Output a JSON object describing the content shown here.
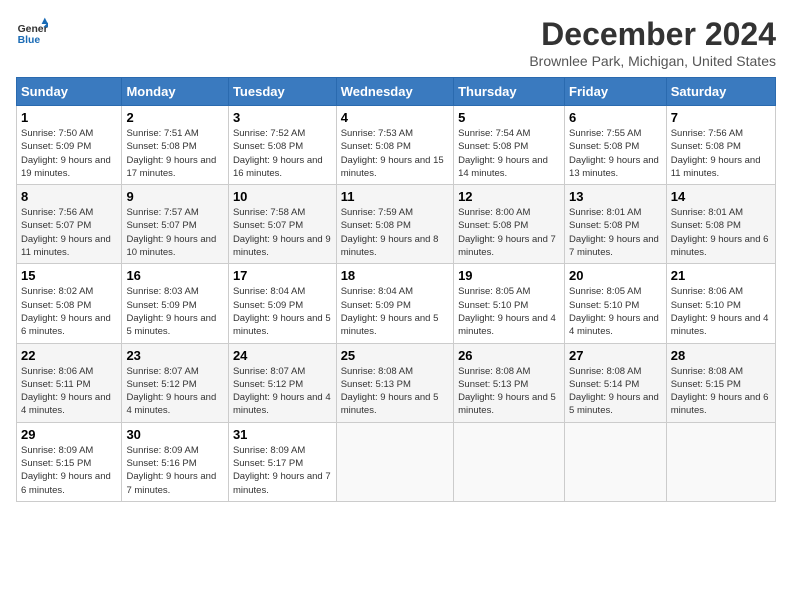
{
  "header": {
    "logo_line1": "General",
    "logo_line2": "Blue",
    "title": "December 2024",
    "subtitle": "Brownlee Park, Michigan, United States"
  },
  "days_of_week": [
    "Sunday",
    "Monday",
    "Tuesday",
    "Wednesday",
    "Thursday",
    "Friday",
    "Saturday"
  ],
  "weeks": [
    [
      {
        "day": "1",
        "sunrise": "7:50 AM",
        "sunset": "5:09 PM",
        "daylight": "9 hours and 19 minutes."
      },
      {
        "day": "2",
        "sunrise": "7:51 AM",
        "sunset": "5:08 PM",
        "daylight": "9 hours and 17 minutes."
      },
      {
        "day": "3",
        "sunrise": "7:52 AM",
        "sunset": "5:08 PM",
        "daylight": "9 hours and 16 minutes."
      },
      {
        "day": "4",
        "sunrise": "7:53 AM",
        "sunset": "5:08 PM",
        "daylight": "9 hours and 15 minutes."
      },
      {
        "day": "5",
        "sunrise": "7:54 AM",
        "sunset": "5:08 PM",
        "daylight": "9 hours and 14 minutes."
      },
      {
        "day": "6",
        "sunrise": "7:55 AM",
        "sunset": "5:08 PM",
        "daylight": "9 hours and 13 minutes."
      },
      {
        "day": "7",
        "sunrise": "7:56 AM",
        "sunset": "5:08 PM",
        "daylight": "9 hours and 11 minutes."
      }
    ],
    [
      {
        "day": "8",
        "sunrise": "7:56 AM",
        "sunset": "5:07 PM",
        "daylight": "9 hours and 11 minutes."
      },
      {
        "day": "9",
        "sunrise": "7:57 AM",
        "sunset": "5:07 PM",
        "daylight": "9 hours and 10 minutes."
      },
      {
        "day": "10",
        "sunrise": "7:58 AM",
        "sunset": "5:07 PM",
        "daylight": "9 hours and 9 minutes."
      },
      {
        "day": "11",
        "sunrise": "7:59 AM",
        "sunset": "5:08 PM",
        "daylight": "9 hours and 8 minutes."
      },
      {
        "day": "12",
        "sunrise": "8:00 AM",
        "sunset": "5:08 PM",
        "daylight": "9 hours and 7 minutes."
      },
      {
        "day": "13",
        "sunrise": "8:01 AM",
        "sunset": "5:08 PM",
        "daylight": "9 hours and 7 minutes."
      },
      {
        "day": "14",
        "sunrise": "8:01 AM",
        "sunset": "5:08 PM",
        "daylight": "9 hours and 6 minutes."
      }
    ],
    [
      {
        "day": "15",
        "sunrise": "8:02 AM",
        "sunset": "5:08 PM",
        "daylight": "9 hours and 6 minutes."
      },
      {
        "day": "16",
        "sunrise": "8:03 AM",
        "sunset": "5:09 PM",
        "daylight": "9 hours and 5 minutes."
      },
      {
        "day": "17",
        "sunrise": "8:04 AM",
        "sunset": "5:09 PM",
        "daylight": "9 hours and 5 minutes."
      },
      {
        "day": "18",
        "sunrise": "8:04 AM",
        "sunset": "5:09 PM",
        "daylight": "9 hours and 5 minutes."
      },
      {
        "day": "19",
        "sunrise": "8:05 AM",
        "sunset": "5:10 PM",
        "daylight": "9 hours and 4 minutes."
      },
      {
        "day": "20",
        "sunrise": "8:05 AM",
        "sunset": "5:10 PM",
        "daylight": "9 hours and 4 minutes."
      },
      {
        "day": "21",
        "sunrise": "8:06 AM",
        "sunset": "5:10 PM",
        "daylight": "9 hours and 4 minutes."
      }
    ],
    [
      {
        "day": "22",
        "sunrise": "8:06 AM",
        "sunset": "5:11 PM",
        "daylight": "9 hours and 4 minutes."
      },
      {
        "day": "23",
        "sunrise": "8:07 AM",
        "sunset": "5:12 PM",
        "daylight": "9 hours and 4 minutes."
      },
      {
        "day": "24",
        "sunrise": "8:07 AM",
        "sunset": "5:12 PM",
        "daylight": "9 hours and 4 minutes."
      },
      {
        "day": "25",
        "sunrise": "8:08 AM",
        "sunset": "5:13 PM",
        "daylight": "9 hours and 5 minutes."
      },
      {
        "day": "26",
        "sunrise": "8:08 AM",
        "sunset": "5:13 PM",
        "daylight": "9 hours and 5 minutes."
      },
      {
        "day": "27",
        "sunrise": "8:08 AM",
        "sunset": "5:14 PM",
        "daylight": "9 hours and 5 minutes."
      },
      {
        "day": "28",
        "sunrise": "8:08 AM",
        "sunset": "5:15 PM",
        "daylight": "9 hours and 6 minutes."
      }
    ],
    [
      {
        "day": "29",
        "sunrise": "8:09 AM",
        "sunset": "5:15 PM",
        "daylight": "9 hours and 6 minutes."
      },
      {
        "day": "30",
        "sunrise": "8:09 AM",
        "sunset": "5:16 PM",
        "daylight": "9 hours and 7 minutes."
      },
      {
        "day": "31",
        "sunrise": "8:09 AM",
        "sunset": "5:17 PM",
        "daylight": "9 hours and 7 minutes."
      },
      null,
      null,
      null,
      null
    ]
  ]
}
